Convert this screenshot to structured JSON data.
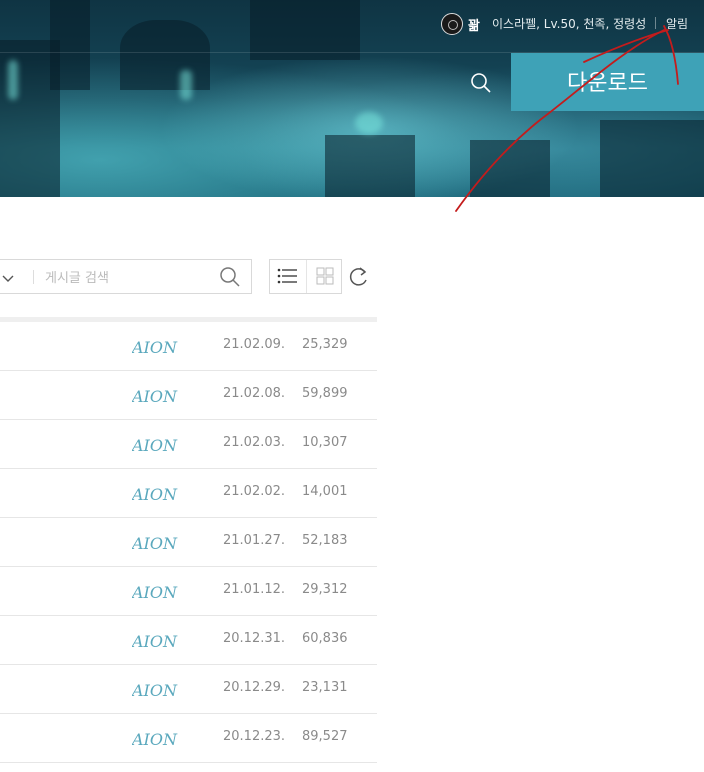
{
  "header": {
    "username": "꽒",
    "character_info": "이스라펠, Lv.50, 천족, 정령성",
    "notification_label": "알림",
    "download_label": "다운로드"
  },
  "search": {
    "placeholder": "게시글 검색"
  },
  "posts": [
    {
      "brand": "AION",
      "date": "21.02.09.",
      "views": "25,329"
    },
    {
      "brand": "AION",
      "date": "21.02.08.",
      "views": "59,899"
    },
    {
      "brand": "AION",
      "date": "21.02.03.",
      "views": "10,307"
    },
    {
      "brand": "AION",
      "date": "21.02.02.",
      "views": "14,001"
    },
    {
      "brand": "AION",
      "date": "21.01.27.",
      "views": "52,183"
    },
    {
      "brand": "AION",
      "date": "21.01.12.",
      "views": "29,312"
    },
    {
      "brand": "AION",
      "date": "20.12.31.",
      "views": "60,836"
    },
    {
      "brand": "AION",
      "date": "20.12.29.",
      "views": "23,131"
    },
    {
      "brand": "AION",
      "date": "20.12.23.",
      "views": "89,527"
    }
  ],
  "colors": {
    "accent": "#3ea2b7",
    "logo": "#5aa8bd",
    "scribble": "#c41c1c"
  },
  "icons": [
    "search-icon",
    "chevron-down-icon",
    "list-view-icon",
    "grid-view-icon",
    "refresh-icon",
    "avatar-emblem-icon"
  ]
}
